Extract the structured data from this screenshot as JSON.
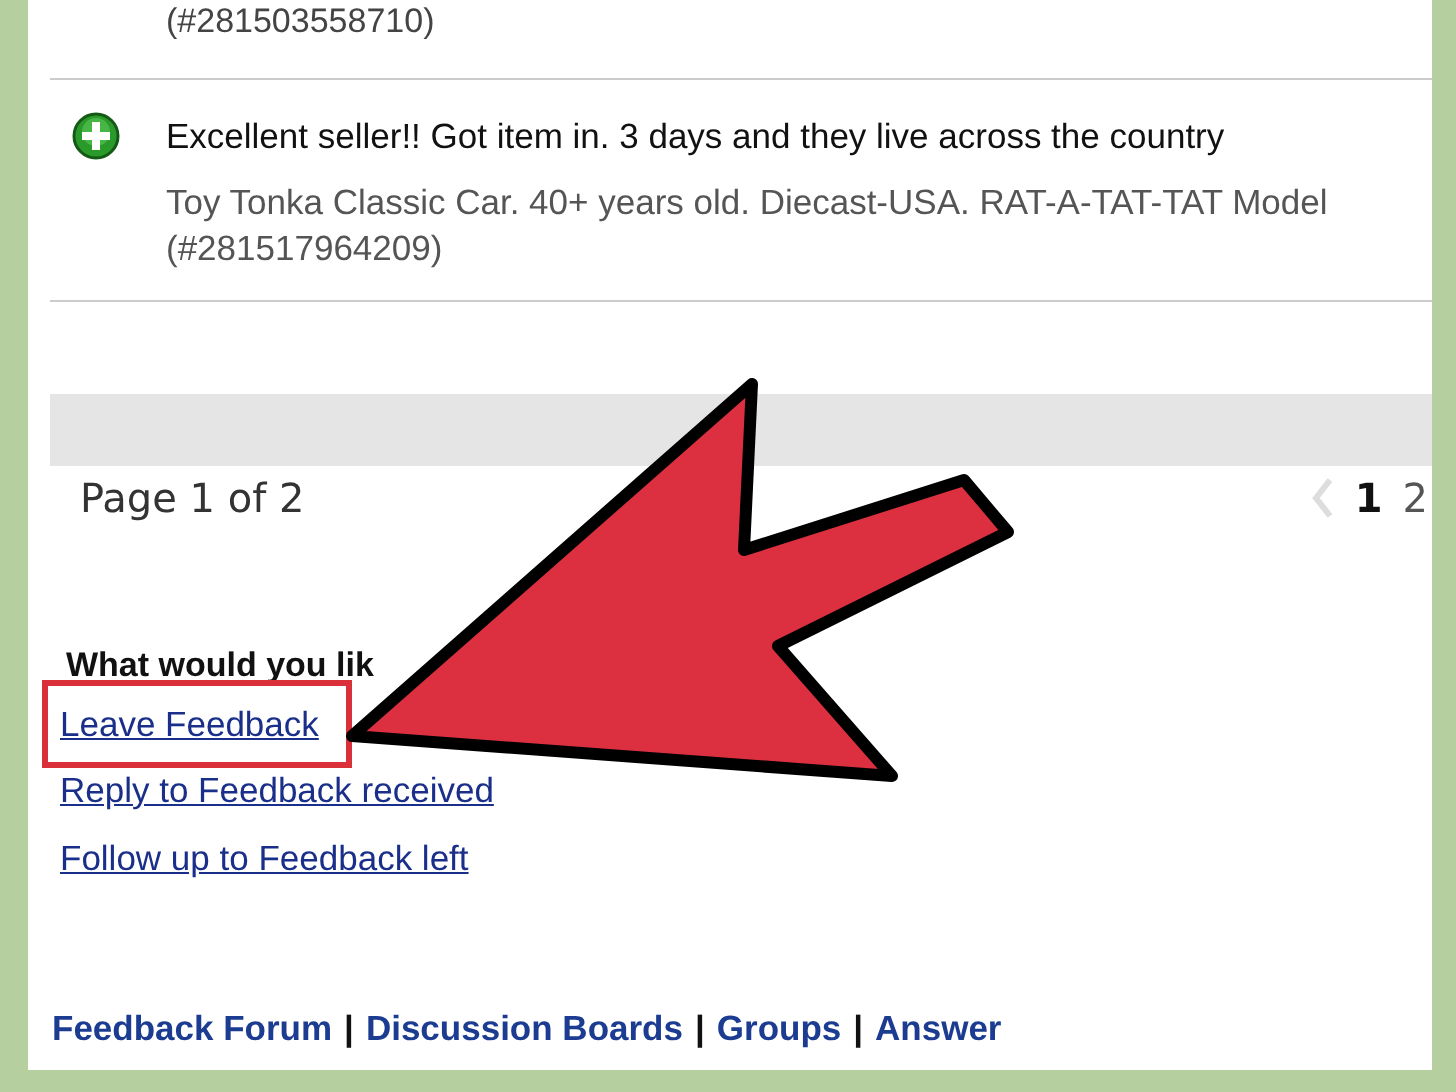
{
  "previous_entry": {
    "item_number": "(#281503558710)"
  },
  "entry": {
    "kind": "positive",
    "comment": "Excellent seller!! Got item in. 3 days and they live across the country",
    "item": "Toy Tonka Classic Car. 40+ years old. Diecast-USA. RAT-A-TAT-TAT Model",
    "item_number": "(#281517964209)"
  },
  "pagination": {
    "label": "Page 1 of 2",
    "pages": [
      {
        "label": "1",
        "selected": true
      },
      {
        "label": "2",
        "selected": false
      }
    ]
  },
  "actions": {
    "prompt": "What would you lik",
    "links": [
      {
        "label": "Leave Feedback",
        "highlighted": true
      },
      {
        "label": "Reply to Feedback received",
        "highlighted": false
      },
      {
        "label": "Follow up to Feedback left",
        "highlighted": false
      }
    ]
  },
  "footer": {
    "separator": "|",
    "links": [
      "Feedback Forum",
      "Discussion Boards",
      "Groups",
      "Answer"
    ]
  }
}
